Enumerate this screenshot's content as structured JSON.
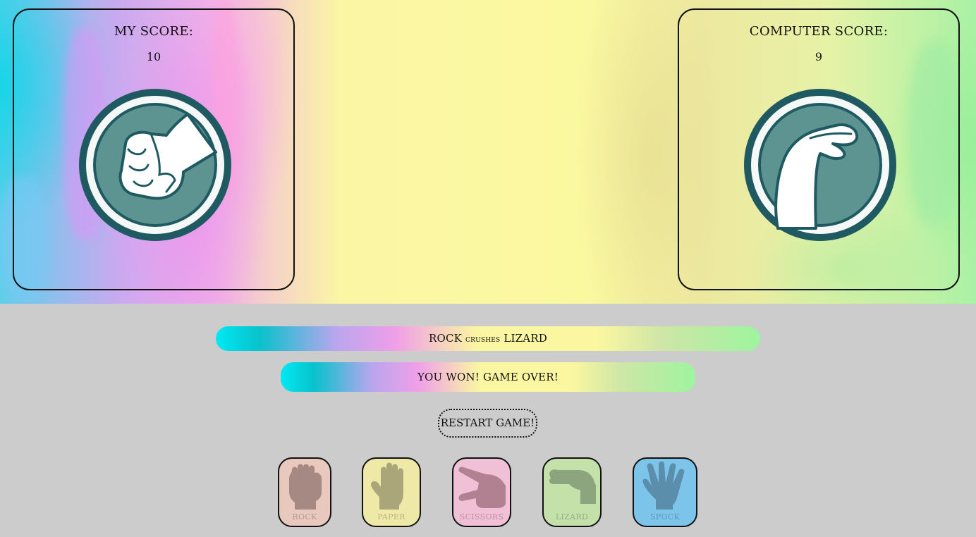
{
  "player": {
    "label": "MY SCORE:",
    "score": "10",
    "choice_icon": "rock-fist-icon"
  },
  "computer": {
    "label": "COMPUTER SCORE:",
    "score": "9",
    "choice_icon": "lizard-hand-icon"
  },
  "result": {
    "outcome_parts": [
      "ROCK",
      "crushes",
      "LIZARD"
    ],
    "status": "YOU WON! GAME OVER!"
  },
  "restart_label": "RESTART GAME!",
  "choices": [
    {
      "label": "ROCK",
      "icon": "rock-fist-icon",
      "bg": "#e9c8bd",
      "fg": "#a68982"
    },
    {
      "label": "PAPER",
      "icon": "paper-hand-icon",
      "bg": "#efe9a7",
      "fg": "#aaa67a"
    },
    {
      "label": "SCISSORS",
      "icon": "scissors-hand-icon",
      "bg": "#f0c0d7",
      "fg": "#b18091"
    },
    {
      "label": "LIZARD",
      "icon": "lizard-hand-icon",
      "bg": "#c3e1a9",
      "fg": "#8da57e"
    },
    {
      "label": "SPOCK",
      "icon": "spock-hand-icon",
      "bg": "#7dc4ea",
      "fg": "#5a8eaa"
    }
  ],
  "colors": {
    "icon_ring": "#1f5a62",
    "icon_fill": "#5d9492",
    "page_bg": "#cbcccb"
  }
}
